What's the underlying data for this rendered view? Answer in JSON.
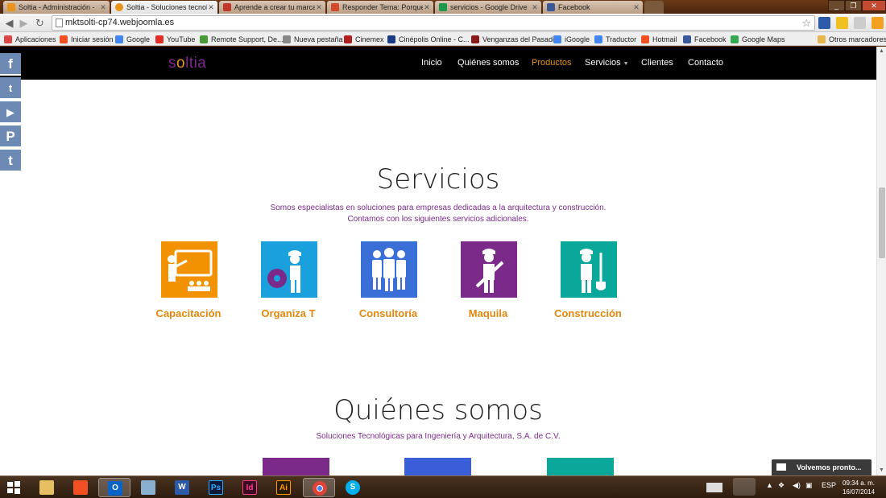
{
  "browser": {
    "tabs": [
      {
        "label": "Soltia - Administración - ",
        "color": "#e8941a",
        "active": false
      },
      {
        "label": "Soltia - Soluciones tecnol",
        "color": "#e8941a",
        "active": true
      },
      {
        "label": "Aprende a crear tu marca",
        "color": "#c0392b",
        "active": false
      },
      {
        "label": "Responder Tema: Porque",
        "color": "#d24a2a",
        "active": false
      },
      {
        "label": "servicios - Google Drive",
        "color": "#1a9a4a",
        "active": false
      },
      {
        "label": "Facebook",
        "color": "#3b5998",
        "active": false
      }
    ],
    "url": "mktsolti-cp74.webjoomla.es",
    "bookmarks": [
      {
        "label": "Aplicaciones",
        "color": "#d44"
      },
      {
        "label": "Iniciar sesión",
        "color": "#f25022"
      },
      {
        "label": "Google",
        "color": "#4285f4"
      },
      {
        "label": "YouTube",
        "color": "#e52d27"
      },
      {
        "label": "Remote Support, De...",
        "color": "#4a9a3a"
      },
      {
        "label": "Nueva pestaña",
        "color": "#888"
      },
      {
        "label": "Cinemex",
        "color": "#b02020"
      },
      {
        "label": "Cinépolis Online - C...",
        "color": "#1a3a8a"
      },
      {
        "label": "Venganzas del Pasado",
        "color": "#8a1a1a"
      },
      {
        "label": "iGoogle",
        "color": "#4285f4"
      },
      {
        "label": "Traductor",
        "color": "#4285f4"
      },
      {
        "label": "Hotmail",
        "color": "#f25022"
      },
      {
        "label": "Facebook",
        "color": "#3b5998"
      },
      {
        "label": "Google Maps",
        "color": "#34a853"
      }
    ],
    "other_bookmarks": "Otros marcadores"
  },
  "site": {
    "logo_prefix": "s",
    "logo_o": "o",
    "logo_suffix": "ltia",
    "menu": [
      "Inicio",
      "Quiénes somos",
      "Productos",
      "Servicios",
      "Clientes",
      "Contacto"
    ],
    "active_menu": "Productos",
    "social": [
      "f",
      "t",
      "▶",
      "P",
      "t"
    ]
  },
  "servicios": {
    "title": "Servicios",
    "subtitle_line1": "Somos especialistas en soluciones para empresas dedicadas a la arquitectura y construcción.",
    "subtitle_line2": "Contamos con los siguientes servicios adicionales.",
    "items": [
      {
        "label": "Capacitación",
        "color": "#f39200",
        "icon": "teacher-board-icon"
      },
      {
        "label": "Organiza T",
        "color": "#1aa0dc",
        "icon": "worker-gear-icon"
      },
      {
        "label": "Consultoría",
        "color": "#3a6fd8",
        "icon": "team-icon"
      },
      {
        "label": "Maquila",
        "color": "#7b2a8a",
        "icon": "worker-tools-icon"
      },
      {
        "label": "Construcción",
        "color": "#0aa89a",
        "icon": "worker-shovel-icon"
      }
    ]
  },
  "quienes": {
    "title": "Quiénes somos",
    "subtitle": "Soluciones Tecnológicas para Ingeniería y Arquitectura, S.A. de C.V.",
    "blocks": [
      "#7b2a8a",
      "#3a5ed8",
      "#0aa89a"
    ]
  },
  "chat": {
    "label": "Volvemos pronto..."
  },
  "taskbar": {
    "apps": [
      "outlook",
      "paint",
      "word",
      "photoshop",
      "indesign",
      "illustrator",
      "chrome",
      "skype"
    ],
    "language": "ESP",
    "time": "09:34 a. m.",
    "date": "16/07/2014"
  },
  "colors": {
    "accent": "#e8941a",
    "brand": "#7b2a8a",
    "nav_bg": "#000000"
  }
}
